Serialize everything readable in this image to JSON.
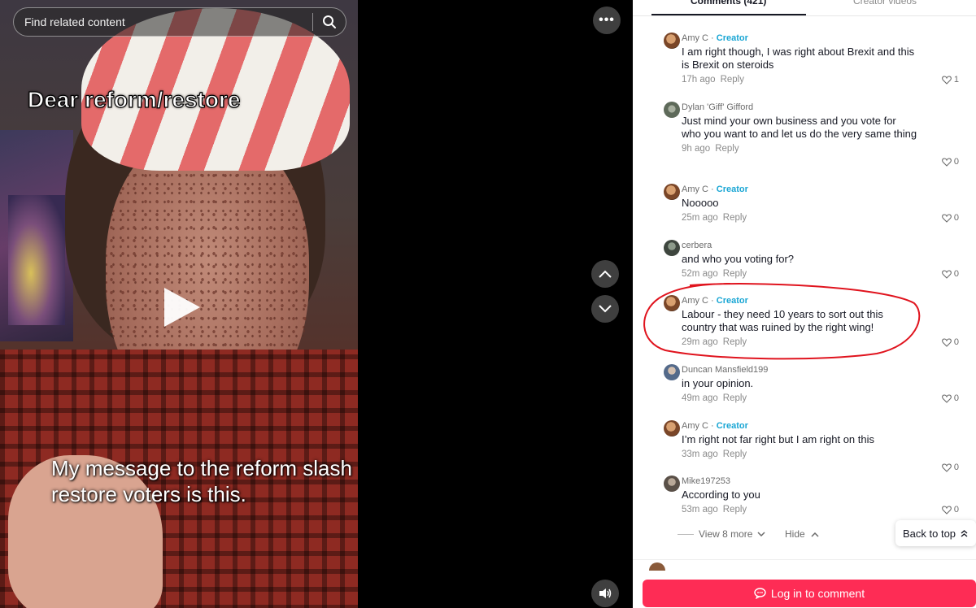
{
  "search": {
    "placeholder": "Find related content"
  },
  "video": {
    "caption_top": "Dear reform/restore",
    "caption_bottom": "My message to the reform slash restore voters is this."
  },
  "tabs": [
    {
      "label": "Comments (421)",
      "active": true
    },
    {
      "label": "Creator videos",
      "active": false
    }
  ],
  "comments": [
    {
      "author": "Amy C",
      "creator": true,
      "creator_label": "Creator",
      "text": "I am right though, I was right about Brexit and this is Brexit on steroids",
      "time": "17h ago",
      "reply": "Reply",
      "likes": "1",
      "avatar": "amy"
    },
    {
      "author": "Dylan 'Giff' Gifford",
      "creator": false,
      "text": "Just mind your own business and you vote for who you want to and let us do the very same thing",
      "time": "9h ago",
      "reply": "Reply",
      "likes": "0",
      "avatar": "dylan"
    },
    {
      "author": "Amy C",
      "creator": true,
      "creator_label": "Creator",
      "text": "Nooooo",
      "time": "25m ago",
      "reply": "Reply",
      "likes": "0",
      "avatar": "amy"
    },
    {
      "author": "cerbera",
      "creator": false,
      "text": "and who you voting for?",
      "time": "52m ago",
      "reply": "Reply",
      "likes": "0",
      "avatar": "cerb"
    },
    {
      "author": "Amy C",
      "creator": true,
      "creator_label": "Creator",
      "text": "Labour - they need 10 years to sort out this country that was ruined by the right wing!",
      "time": "29m ago",
      "reply": "Reply",
      "likes": "0",
      "avatar": "amy"
    },
    {
      "author": "Duncan Mansfield199",
      "creator": false,
      "text": "in your opinion.",
      "time": "49m ago",
      "reply": "Reply",
      "likes": "0",
      "avatar": "duncan"
    },
    {
      "author": "Amy C",
      "creator": true,
      "creator_label": "Creator",
      "text": "I’m right not far right but I am right on this",
      "time": "33m ago",
      "reply": "Reply",
      "likes": "0",
      "avatar": "amy"
    },
    {
      "author": "Mike197253",
      "creator": false,
      "text": "According to you",
      "time": "53m ago",
      "reply": "Reply",
      "likes": "0",
      "avatar": "mike"
    }
  ],
  "thread": {
    "view_more": "View 8 more",
    "hide": "Hide"
  },
  "back_to_top": "Back to top",
  "login_button": "Log in to comment",
  "colors": {
    "accent": "#fe2c55",
    "creator": "#1aa6d4",
    "annotation": "#e0141e"
  },
  "icons": [
    "search-icon",
    "more-icon",
    "chevron-up-icon",
    "chevron-down-icon",
    "volume-icon",
    "play-icon",
    "heart-icon",
    "comment-bubble-icon",
    "double-chevron-up-icon"
  ]
}
